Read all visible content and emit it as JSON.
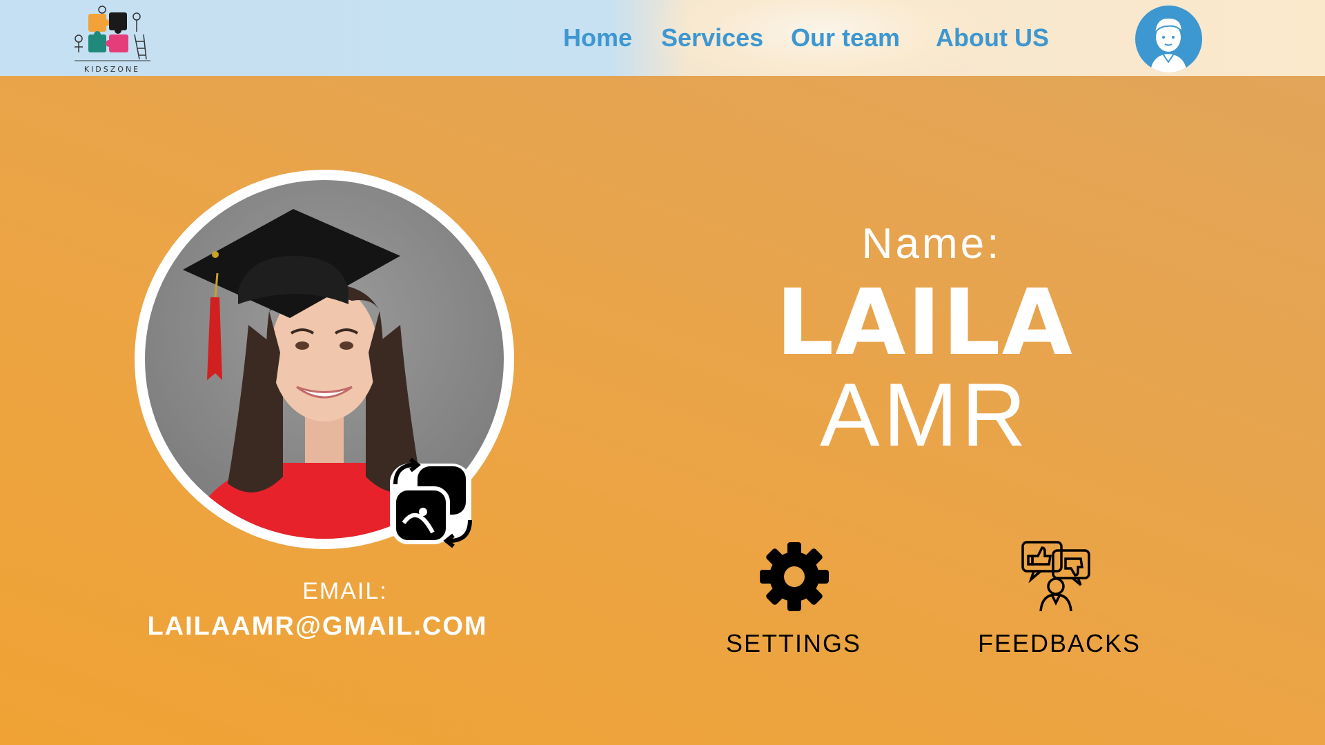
{
  "header": {
    "logo_text": "KIDSZONE",
    "nav": [
      {
        "label": "Home"
      },
      {
        "label": "Services"
      },
      {
        "label": "Our team"
      },
      {
        "label": "About US"
      }
    ]
  },
  "profile": {
    "name_label": "Name:",
    "first_name": "LAILA",
    "last_name": "AMR",
    "email_label": "EMAIL:",
    "email": "LAILAAMR@GMAIL.COM"
  },
  "actions": {
    "settings_label": "SETTINGS",
    "feedbacks_label": "FEEDBACKS"
  },
  "colors": {
    "accent_blue": "#3d97d1",
    "background_orange": "#eba446",
    "text_white": "#ffffff"
  },
  "icons": [
    "kidszone-logo",
    "user-avatar-icon",
    "change-photo-icon",
    "gear-icon",
    "feedback-icon"
  ]
}
